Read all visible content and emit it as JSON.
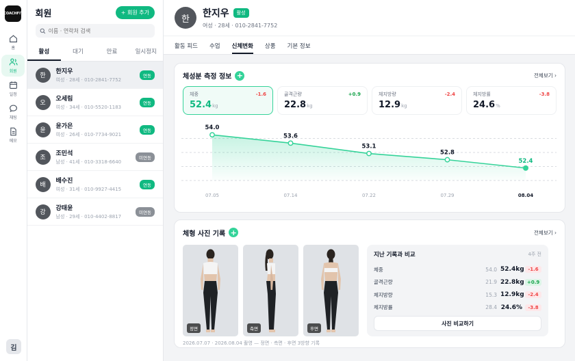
{
  "app": {
    "logo_text": "COACHFIT"
  },
  "rail": {
    "items": [
      {
        "label": "홈",
        "icon": "home-icon"
      },
      {
        "label": "회원",
        "icon": "users-icon"
      },
      {
        "label": "일정",
        "icon": "calendar-icon"
      },
      {
        "label": "채팅",
        "icon": "chat-icon"
      },
      {
        "label": "메모",
        "icon": "memo-icon"
      }
    ],
    "user_initial": "김"
  },
  "members": {
    "title": "회원",
    "add_label": "+ 회원 추가",
    "search_placeholder": "이름 · 연락처 검색",
    "tabs": [
      "활성",
      "대기",
      "만료",
      "일시정지"
    ],
    "list": [
      {
        "initial": "한",
        "name": "한지우",
        "sub": "여성 · 28세 · 010-2841-7752",
        "status": "연동"
      },
      {
        "initial": "오",
        "name": "오세림",
        "sub": "여성 · 34세 · 010-5520-1183",
        "status": "연동"
      },
      {
        "initial": "윤",
        "name": "윤가은",
        "sub": "여성 · 26세 · 010-7734-9021",
        "status": "연동"
      },
      {
        "initial": "조",
        "name": "조민석",
        "sub": "남성 · 41세 · 010-3318-6640",
        "status": "미연동"
      },
      {
        "initial": "배",
        "name": "배수진",
        "sub": "여성 · 31세 · 010-9927-4415",
        "status": "연동"
      },
      {
        "initial": "강",
        "name": "강태윤",
        "sub": "남성 · 29세 · 010-4402-8817",
        "status": "미연동"
      }
    ]
  },
  "profile": {
    "initial": "한",
    "name": "한지우",
    "status": "활성",
    "sub": "여성 · 28세 · 010-2841-7752",
    "tabs": [
      "활동 피드",
      "수업",
      "신체변화",
      "상품",
      "기본 정보"
    ]
  },
  "body_comp": {
    "title": "체성분 측정 정보",
    "view_all": "전체보기 ›",
    "metrics": [
      {
        "label": "체중",
        "value": "52.4",
        "unit": "kg",
        "delta": "-1.6"
      },
      {
        "label": "골격근량",
        "value": "22.8",
        "unit": "kg",
        "delta": "+0.9"
      },
      {
        "label": "체지방량",
        "value": "12.9",
        "unit": "kg",
        "delta": "-2.4"
      },
      {
        "label": "체지방률",
        "value": "24.6",
        "unit": "%",
        "delta": "-3.8"
      }
    ]
  },
  "chart_data": {
    "type": "line",
    "title": "",
    "xlabel": "",
    "ylabel": "",
    "categories": [
      "07.05",
      "07.14",
      "07.22",
      "07.29",
      "08.04"
    ],
    "series": [
      {
        "values": [
          54.0,
          53.6,
          53.1,
          52.8,
          52.4
        ]
      }
    ],
    "value_labels": [
      "54.0",
      "53.6",
      "53.1",
      "52.8",
      "52.4"
    ],
    "ylim": [
      51.8,
      54.5
    ],
    "grid": true,
    "color": "#34d399"
  },
  "photos": {
    "title": "체형 사진 기록",
    "view_all": "전체보기 ›",
    "labels": [
      "정면",
      "측면",
      "후면"
    ],
    "footer": "2026.07.07 · 2026.08.04 촬영 — 정면 · 측면 · 후면 3방향 기록",
    "compare": {
      "title": "지난 기록과 비교",
      "period": "4주 전",
      "rows": [
        {
          "label": "체중",
          "prev": "54.0",
          "cur": "52.4kg",
          "delta": "-1.6"
        },
        {
          "label": "골격근량",
          "prev": "21.9",
          "cur": "22.8kg",
          "delta": "+0.9"
        },
        {
          "label": "체지방량",
          "prev": "15.3",
          "cur": "12.9kg",
          "delta": "-2.4"
        },
        {
          "label": "체지방률",
          "prev": "28.4",
          "cur": "24.6%",
          "delta": "-3.8"
        }
      ],
      "button": "사진 비교하기"
    }
  }
}
